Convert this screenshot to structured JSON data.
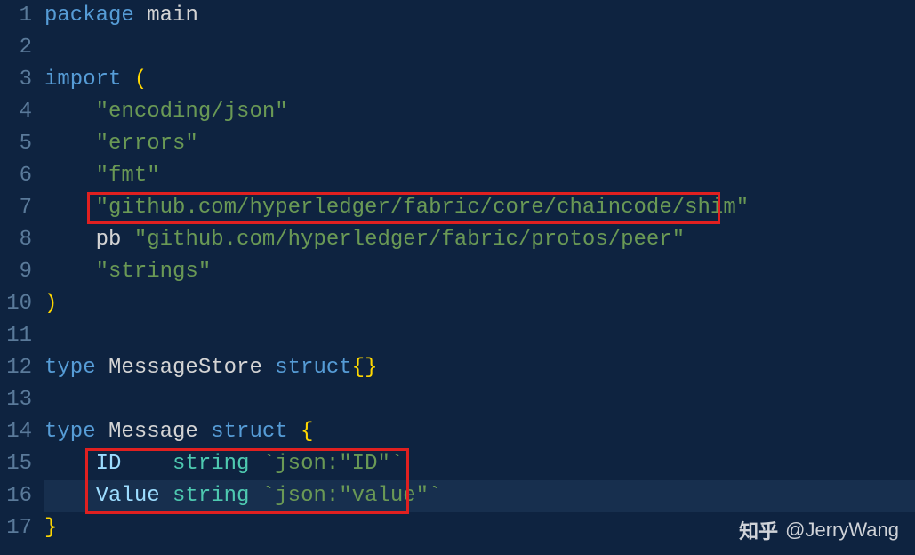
{
  "lines": {
    "n1": "1",
    "n2": "2",
    "n3": "3",
    "n4": "4",
    "n5": "5",
    "n6": "6",
    "n7": "7",
    "n8": "8",
    "n9": "9",
    "n10": "10",
    "n11": "11",
    "n12": "12",
    "n13": "13",
    "n14": "14",
    "n15": "15",
    "n16": "16",
    "n17": "17"
  },
  "code": {
    "package_kw": "package",
    "package_name": " main",
    "import_kw": "import",
    "open_paren": " (",
    "close_paren": ")",
    "imp_json": "\"encoding/json\"",
    "imp_errors": "\"errors\"",
    "imp_fmt": "\"fmt\"",
    "imp_shim": "\"github.com/hyperledger/fabric/core/chaincode/shim\"",
    "imp_pb_alias": "pb ",
    "imp_pb": "\"github.com/hyperledger/fabric/protos/peer\"",
    "imp_strings": "\"strings\"",
    "type_kw1": "type",
    "ms_name": " MessageStore ",
    "struct_kw1": "struct",
    "ms_braces": "{}",
    "type_kw2": "type",
    "m_name": " Message ",
    "struct_kw2": "struct",
    "open_brace": " {",
    "close_brace": "}",
    "field_id": "ID    ",
    "field_val": "Value ",
    "string_type": "string",
    "tag_id": " `json:\"ID\"`",
    "tag_val": " `json:\"value\"`",
    "indent1": "    ",
    "indent2": "    "
  },
  "watermark": {
    "icon": "知乎",
    "text": " @JerryWang"
  }
}
